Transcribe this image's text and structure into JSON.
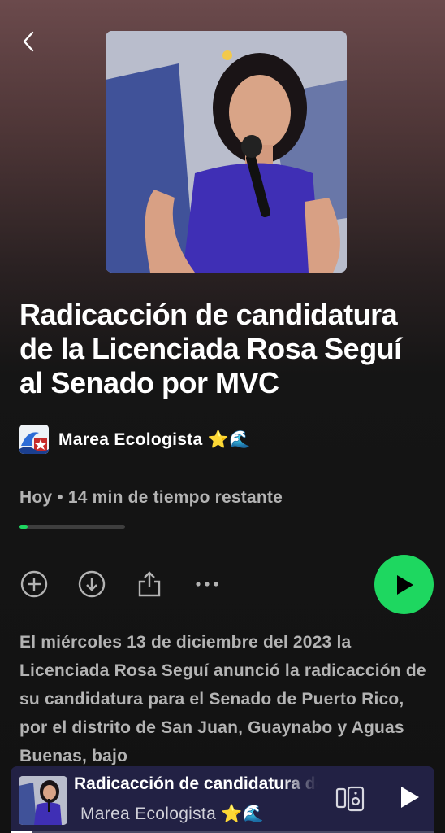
{
  "episode": {
    "title": "Radicacción de candidatura de la Licenciada Rosa Seguí al Senado por MVC",
    "show_name": "Marea Ecologista",
    "show_emoji": "⭐🌊",
    "meta": "Hoy • 14 min de tiempo restante",
    "progress_fraction": 0.08,
    "description": "El miércoles 13 de diciembre del 2023 la Licenciada Rosa Seguí anunció la radicacción de su candidatura para el Senado de Puerto Rico, por el distrito de San Juan, Guaynabo y Aguas Buenas, bajo"
  },
  "actions": [
    "add-icon",
    "download-icon",
    "share-icon",
    "more-icon"
  ],
  "mini_player": {
    "title": "Radicacción de candidatura de la Licenciada Rosa Seguí al Senado por MVC",
    "subtitle": "Marea Ecologista",
    "subtitle_emoji": "⭐🌊",
    "progress_fraction": 0.05
  },
  "colors": {
    "accent": "#1ed760",
    "mini_player_bg": "#222144",
    "muted_text": "#b3b3b3"
  }
}
